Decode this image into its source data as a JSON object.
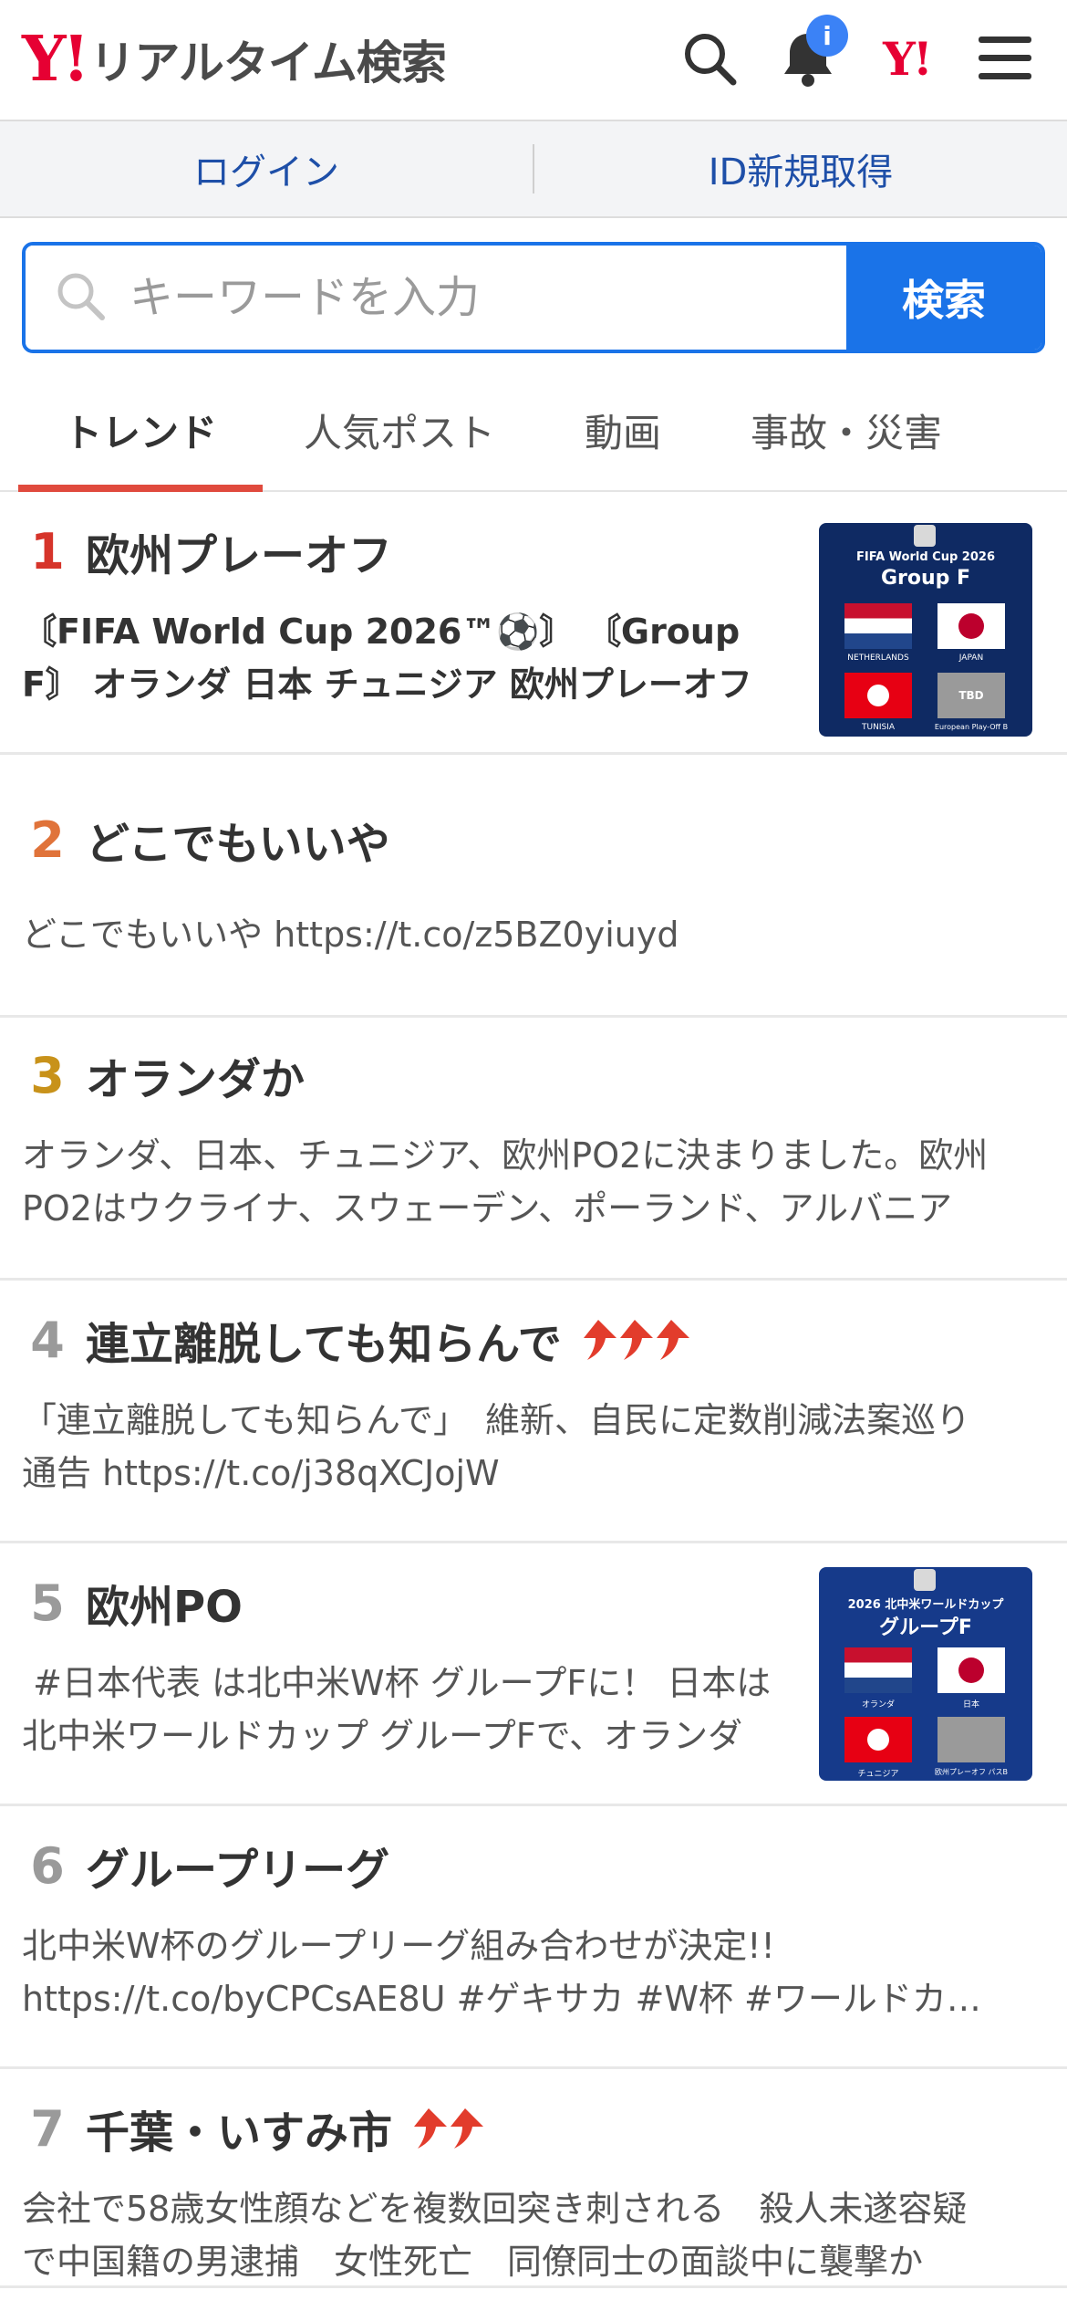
{
  "app": {
    "logo_mark": "Y!",
    "logo_title": "リアルタイム検索",
    "notification_badge": "i",
    "yahoo_mark": "Y!"
  },
  "login_bar": {
    "login": "ログイン",
    "register": "ID新規取得"
  },
  "search": {
    "placeholder": "キーワードを入力",
    "button": "検索"
  },
  "tabs": [
    {
      "label": "トレンド",
      "active": true
    },
    {
      "label": "人気ポスト",
      "active": false
    },
    {
      "label": "動画",
      "active": false
    },
    {
      "label": "事故・災害",
      "active": false
    }
  ],
  "colors": {
    "rank1": "#d6342a",
    "rank2": "#e0733a",
    "rank3": "#c8921a",
    "rank_other": "#9a9a9a",
    "accent_blue": "#1a73e8",
    "tab_underline": "#e04a3d",
    "trend_arrow": "#e23c2c"
  },
  "trends": [
    {
      "rank": "1",
      "title": "欧州プレーオフ",
      "arrows": 0,
      "desc": "〘FIFA World Cup 2026™⚽〙 〘Group F〙 ​オランダ ​日本 ​チュニジア 欧州プレーオフ",
      "desc_bold_first_line": true,
      "thumb": {
        "header": "FIFA World Cup 2026",
        "group": "Group F",
        "teams": [
          "NETHERLANDS",
          "JAPAN",
          "TUNISIA",
          "European Play-Off B"
        ],
        "tbd": "TBD"
      }
    },
    {
      "rank": "2",
      "title": "どこでもいいや",
      "arrows": 0,
      "desc": "どこでもいいや https://t.co/z5BZ0yiuyd"
    },
    {
      "rank": "3",
      "title": "オランダか",
      "arrows": 0,
      "desc": "オランダ、日本、チュニジア、欧州PO2に決まりました。欧州PO2はウクライナ、スウェーデン、ポーランド、アルバニア"
    },
    {
      "rank": "4",
      "title": "連立離脱しても知らんで",
      "arrows": 3,
      "desc": "「連立離脱しても知らんで」　維新、自民に定数削減法案巡り通告 https://t.co/j38qXCJojW"
    },
    {
      "rank": "5",
      "title": "欧州PO",
      "arrows": 0,
      "desc": "​ #日本代表 は北中米W杯 グループFに！ ​日本は北中米ワールドカップ グループFで、オランダ",
      "thumb": {
        "header": "2026 北中米ワールドカップ",
        "group": "グループF",
        "teams": [
          "オランダ",
          "日本",
          "チュニジア",
          "欧州プレーオフ パスB"
        ]
      }
    },
    {
      "rank": "6",
      "title": "グループリーグ",
      "arrows": 0,
      "desc": "北中米W杯のグループリーグ組み合わせが決定!! https://t.co/byCPCsAE8U #ゲキサカ #W杯 #ワールドカップ"
    },
    {
      "rank": "7",
      "title": "千葉・いすみ市",
      "arrows": 2,
      "desc": "会社で58歳女性顔などを複数回突き刺される　殺人未遂容疑で中国籍の男逮捕　女性死亡　同僚同士の面談中に襲撃か"
    }
  ]
}
